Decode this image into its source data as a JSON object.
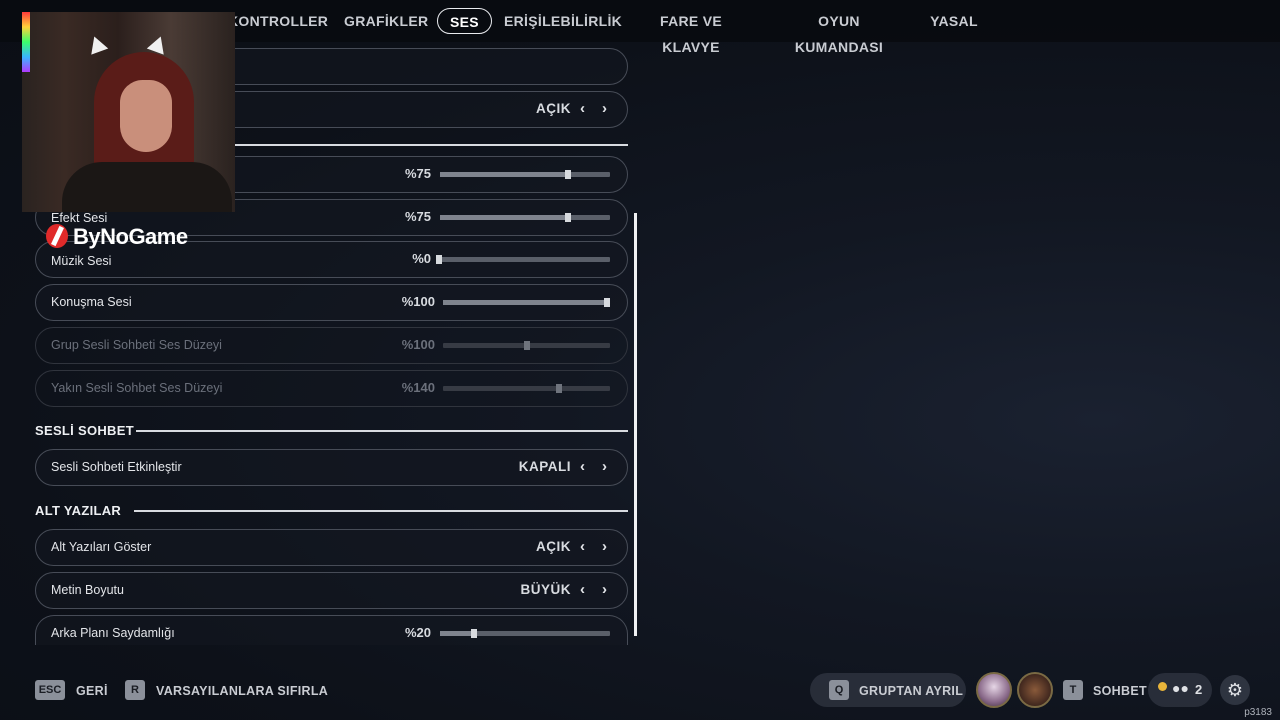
{
  "nav": {
    "tabs": [
      {
        "label": "KONTROLLER"
      },
      {
        "label": "GRAFİKLER"
      },
      {
        "label": "SES"
      },
      {
        "label": "ERİŞİLEBİLİRLİK"
      },
      {
        "label": "FARE VE KLAVYE"
      },
      {
        "label": "OYUN KUMANDASI"
      },
      {
        "label": "YASAL"
      }
    ],
    "active": "SES"
  },
  "rows": {
    "top_toggle": {
      "value": "AÇIK"
    },
    "first_volume": {
      "value_text": "%75",
      "level": 0.75
    },
    "effect_volume": {
      "label": "Efekt Sesi",
      "value_text": "%75",
      "level": 0.75
    },
    "music_volume": {
      "label": "Müzik Sesi",
      "value_text": "%0",
      "level": 0.0
    },
    "speech_volume": {
      "label": "Konuşma Sesi",
      "value_text": "%100",
      "level": 1.0
    },
    "group_voice_volume": {
      "label": "Grup Sesli Sohbeti Ses Düzeyi",
      "value_text": "%100",
      "level": 0.5
    },
    "proximity_voice_volume": {
      "label": "Yakın Sesli Sohbet Ses Düzeyi",
      "value_text": "%140",
      "level": 0.7
    }
  },
  "sections": {
    "voice_chat": {
      "title": "SESLİ SOHBET",
      "enable": {
        "label": "Sesli Sohbeti Etkinleştir",
        "value": "KAPALI"
      }
    },
    "subtitles": {
      "title": "ALT YAZILAR",
      "show": {
        "label": "Alt Yazıları Göster",
        "value": "AÇIK"
      },
      "text_size": {
        "label": "Metin Boyutu",
        "value": "BÜYÜK"
      },
      "bg_opacity": {
        "label": "Arka Planı Saydamlığı",
        "value_text": "%20",
        "level": 0.2
      }
    }
  },
  "overlay": {
    "logo_text": "ByNoGame"
  },
  "footer": {
    "back": {
      "key": "ESC",
      "label": "GERİ"
    },
    "reset": {
      "key": "R",
      "label": "VARSAYILANLARA SIFIRLA"
    },
    "leave_group": {
      "key": "Q",
      "label": "GRUPTAN AYRIL"
    },
    "chat": {
      "key": "T",
      "label": "SOHBET"
    },
    "party_count": "2",
    "build": "p3183"
  },
  "icons": {
    "left": "‹",
    "right": "›",
    "gear": "⚙"
  }
}
